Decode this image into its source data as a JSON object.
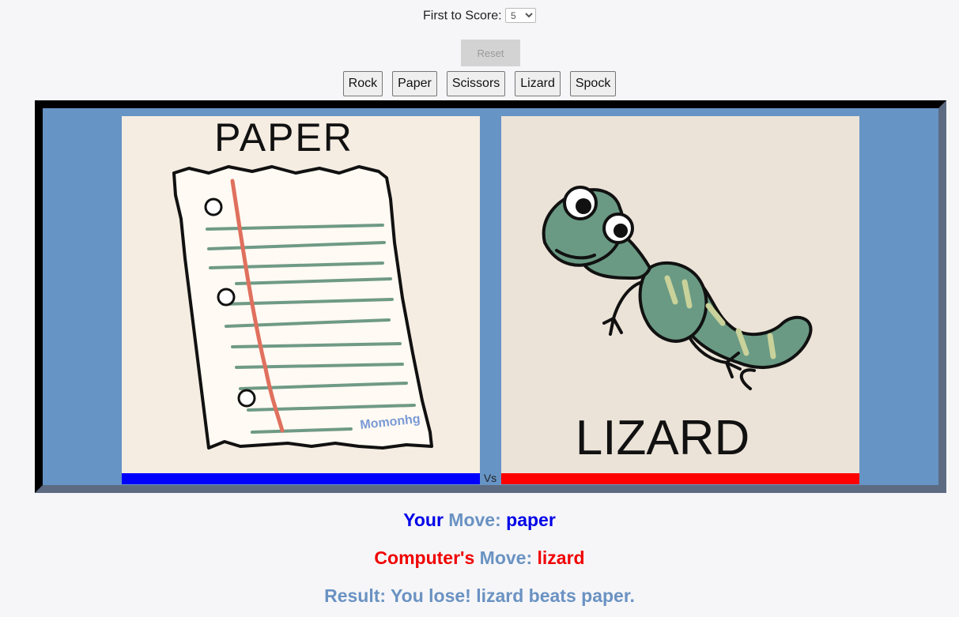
{
  "settings": {
    "first_to_score_label": "First to Score:",
    "first_to_score_value": "5"
  },
  "reset_label": "Reset",
  "moves": {
    "rock": "Rock",
    "paper": "Paper",
    "scissors": "Scissors",
    "lizard": "Lizard",
    "spock": "Spock"
  },
  "arena": {
    "player_card_label": "PAPER",
    "player_signature": "Momonhg",
    "computer_card_label": "LIZARD",
    "vs_label": "Vs",
    "player_bar_color": "#0000ff",
    "computer_bar_color": "#ff0000"
  },
  "summary": {
    "your_label": "Your",
    "computers_label": "Computer's",
    "move_label": "Move:",
    "player_move": "paper",
    "computer_move": "lizard",
    "result_text": "Result: You lose! lizard beats paper."
  }
}
